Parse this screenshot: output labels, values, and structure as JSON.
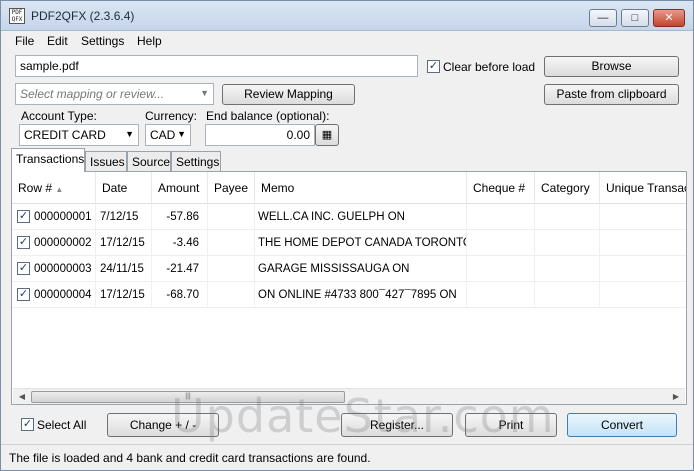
{
  "window": {
    "title": "PDF2QFX (2.3.6.4)",
    "icon": "pdf-app-icon"
  },
  "menu": [
    "File",
    "Edit",
    "Settings",
    "Help"
  ],
  "file": {
    "value": "sample.pdf"
  },
  "clear_before_load": {
    "label": "Clear before load",
    "checked": true
  },
  "buttons": {
    "browse": "Browse",
    "paste": "Paste from clipboard",
    "review_mapping": "Review Mapping",
    "change": "Change + / -",
    "register": "Register...",
    "print": "Print",
    "convert": "Convert"
  },
  "mapping": {
    "placeholder": "Select mapping or review..."
  },
  "account_type": {
    "label": "Account Type:",
    "value": "CREDIT CARD"
  },
  "currency": {
    "label": "Currency:",
    "value": "CAD"
  },
  "end_balance": {
    "label": "End balance (optional):",
    "value": "0.00"
  },
  "tabs": [
    "Transactions",
    "Issues",
    "Source",
    "Settings"
  ],
  "columns": [
    "Row #",
    "Date",
    "Amount",
    "Payee",
    "Memo",
    "Cheque #",
    "Category",
    "Unique Transact"
  ],
  "rows": [
    {
      "row": "000000001",
      "date": "7/12/15",
      "amount": "-57.86",
      "payee": "",
      "memo": "WELL.CA INC. GUELPH ON",
      "cheque": "",
      "category": "",
      "unique": ""
    },
    {
      "row": "000000002",
      "date": "17/12/15",
      "amount": "-3.46",
      "payee": "",
      "memo": "THE HOME DEPOT CANADA TORONTO ON",
      "cheque": "",
      "category": "",
      "unique": ""
    },
    {
      "row": "000000003",
      "date": "24/11/15",
      "amount": "-21.47",
      "payee": "",
      "memo": "GARAGE MISSISSAUGA ON",
      "cheque": "",
      "category": "",
      "unique": ""
    },
    {
      "row": "000000004",
      "date": "17/12/15",
      "amount": "-68.70",
      "payee": "",
      "memo": "ON ONLINE #4733 800¯427¯7895 ON",
      "cheque": "",
      "category": "",
      "unique": ""
    }
  ],
  "select_all": {
    "label": "Select All",
    "checked": true
  },
  "status": "The file is loaded and 4 bank and credit card transactions are found.",
  "watermark": "UpdateStar.com"
}
